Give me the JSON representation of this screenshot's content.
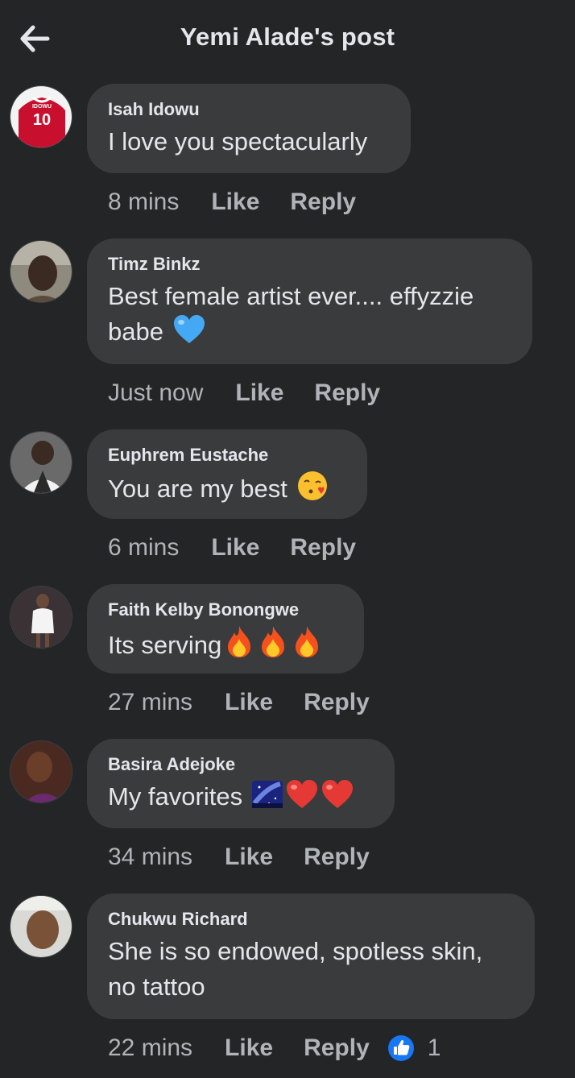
{
  "header": {
    "title": "Yemi Alade's post"
  },
  "comments": [
    {
      "author": "Isah Idowu",
      "text": "I love you spectacularly",
      "time": "8 mins",
      "like": "Like",
      "reply": "Reply"
    },
    {
      "author": "Timz Binkz",
      "text1": "Best female artist ever.... effyzzie",
      "text2": "babe",
      "time": "Just now",
      "like": "Like",
      "reply": "Reply"
    },
    {
      "author": "Euphrem Eustache",
      "text": "You are my best",
      "time": "6 mins",
      "like": "Like",
      "reply": "Reply"
    },
    {
      "author": "Faith Kelby Bonongwe",
      "text": "Its serving",
      "time": "27 mins",
      "like": "Like",
      "reply": "Reply"
    },
    {
      "author": "Basira Adejoke",
      "text": "My favorites",
      "time": "34 mins",
      "like": "Like",
      "reply": "Reply"
    },
    {
      "author": "Chukwu Richard",
      "text1": "She is so endowed, spotless skin,",
      "text2": "no tattoo",
      "time": "22 mins",
      "like": "Like",
      "reply": "Reply",
      "reaction_count": "1"
    }
  ],
  "avatar_jersey_text": {
    "name": "IDOWU",
    "number": "10"
  },
  "colors": {
    "background": "#242526",
    "bubble": "#3a3b3c",
    "text": "#e4e6eb",
    "muted": "#b0b3b8",
    "like_blue": "#1877f2"
  },
  "icons": {
    "back": "arrow-left-icon",
    "like_reaction": "thumbs-up-icon"
  }
}
